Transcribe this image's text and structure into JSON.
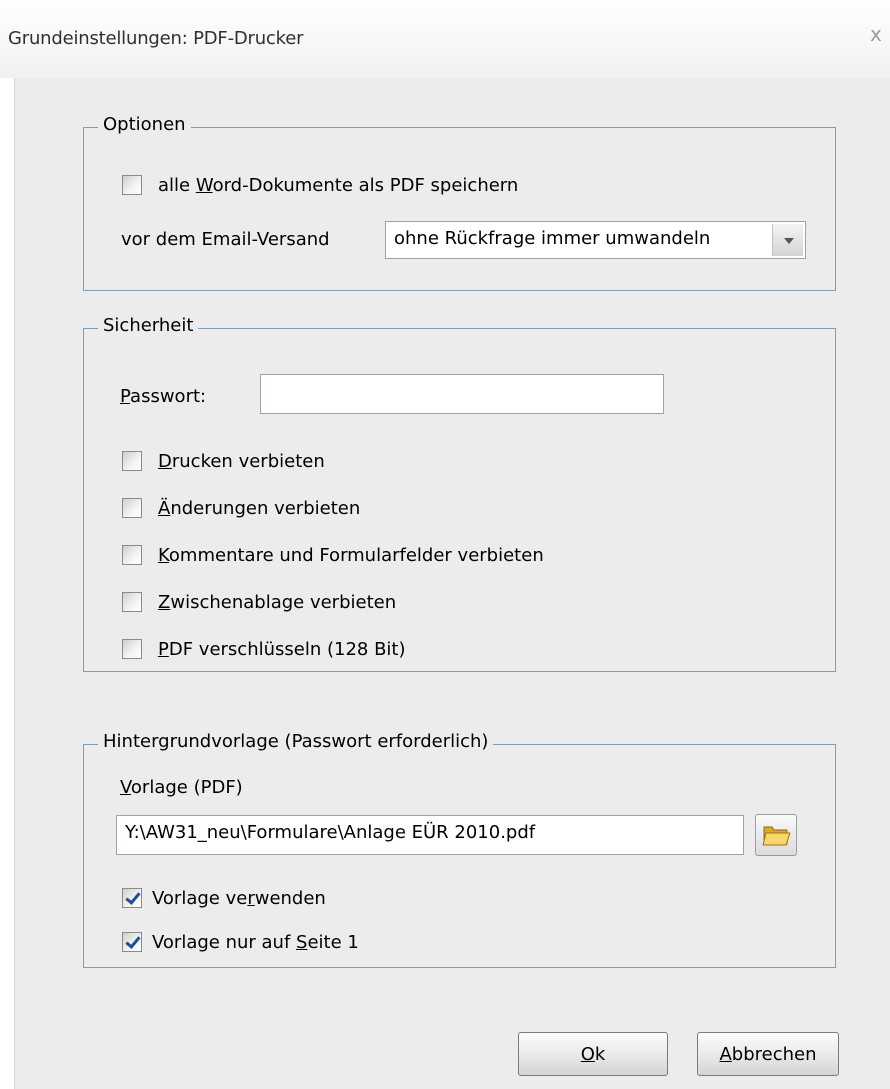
{
  "window": {
    "title": "Grundeinstellungen: PDF-Drucker",
    "close_glyph": "x"
  },
  "optionen": {
    "legend": "Optionen",
    "save_all_word": {
      "label_pre": "alle ",
      "label_key": "W",
      "label_post": "ord-Dokumente als PDF speichern",
      "checked": false
    },
    "email_label": "vor dem Email-Versand",
    "email_select_value": "ohne Rückfrage immer umwandeln"
  },
  "sicherheit": {
    "legend": "Sicherheit",
    "password_label_key": "P",
    "password_label_rest": "asswort:",
    "password_value": "",
    "checkboxes": [
      {
        "key": "D",
        "rest": "rucken verbieten",
        "checked": false
      },
      {
        "key": "Ä",
        "rest": "nderungen verbieten",
        "checked": false
      },
      {
        "key": "K",
        "rest": "ommentare und Formularfelder verbieten",
        "checked": false
      },
      {
        "key": "Z",
        "rest": "wischenablage verbieten",
        "checked": false
      },
      {
        "key": "P",
        "rest": "DF verschlüsseln (128 Bit)",
        "checked": false
      }
    ]
  },
  "hintergrund": {
    "legend": "Hintergrundvorlage (Passwort erforderlich)",
    "vorlage_label_key": "V",
    "vorlage_label_rest": "orlage (PDF)",
    "vorlage_path": "Y:\\AW31_neu\\Formulare\\Anlage EÜR 2010.pdf",
    "use_template": {
      "pre": "Vorlage ve",
      "key": "r",
      "post": "wenden",
      "checked": true
    },
    "page1_only": {
      "pre": "Vorlage nur auf ",
      "key": "S",
      "post": "eite 1",
      "checked": true
    }
  },
  "buttons": {
    "ok_key": "O",
    "ok_rest": "k",
    "cancel_key": "A",
    "cancel_rest": "bbrechen"
  },
  "icons": {
    "folder": "folder-open-icon",
    "checkmark": "checkmark-icon",
    "dropdown": "chevron-down-icon",
    "close": "close-icon"
  }
}
